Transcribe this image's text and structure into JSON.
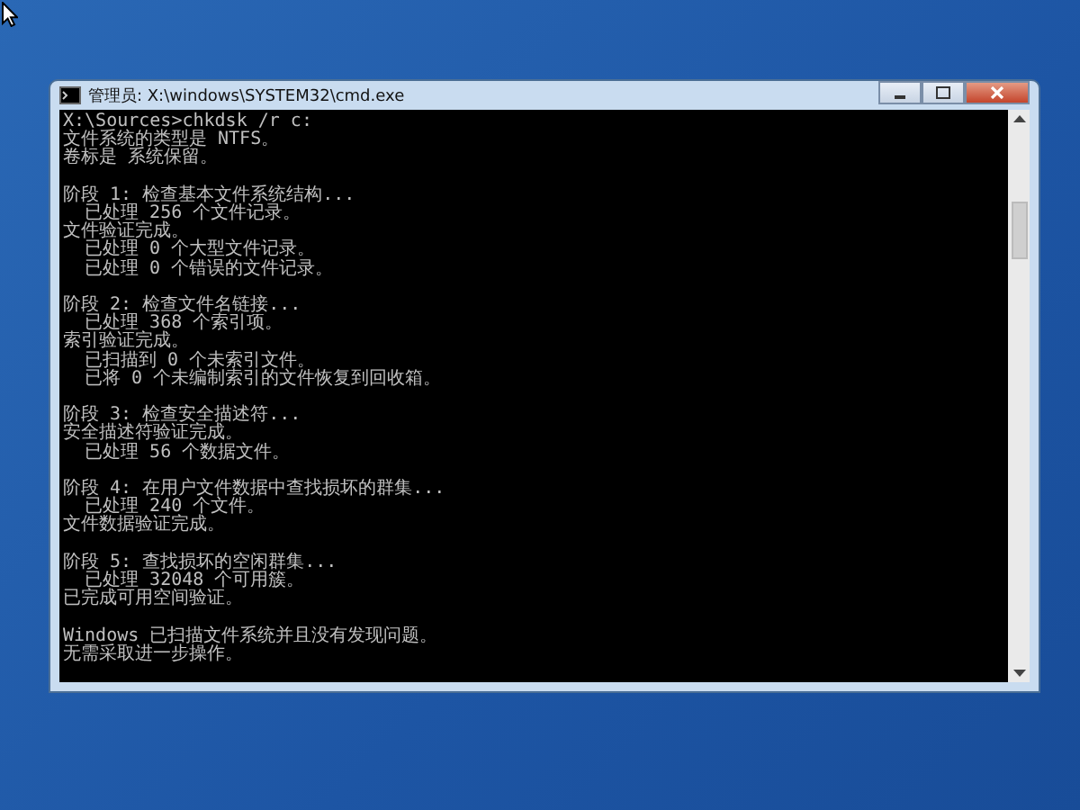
{
  "window": {
    "title": "管理员: X:\\windows\\SYSTEM32\\cmd.exe"
  },
  "console": {
    "blocks": [
      [
        "X:\\Sources>chkdsk /r c:",
        "文件系统的类型是 NTFS。",
        "卷标是 系统保留。"
      ],
      [
        "阶段 1: 检查基本文件系统结构...",
        "  已处理 256 个文件记录。",
        "文件验证完成。",
        "  已处理 0 个大型文件记录。",
        "  已处理 0 个错误的文件记录。"
      ],
      [
        "阶段 2: 检查文件名链接...",
        "  已处理 368 个索引项。",
        "索引验证完成。",
        "  已扫描到 0 个未索引文件。",
        "  已将 0 个未编制索引的文件恢复到回收箱。"
      ],
      [
        "阶段 3: 检查安全描述符...",
        "安全描述符验证完成。",
        "  已处理 56 个数据文件。"
      ],
      [
        "阶段 4: 在用户文件数据中查找损坏的群集...",
        "  已处理 240 个文件。",
        "文件数据验证完成。"
      ],
      [
        "阶段 5: 查找损坏的空闲群集...",
        "  已处理 32048 个可用簇。",
        "已完成可用空间验证。"
      ],
      [
        "Windows 已扫描文件系统并且没有发现问题。",
        "无需采取进一步操作。"
      ]
    ]
  }
}
